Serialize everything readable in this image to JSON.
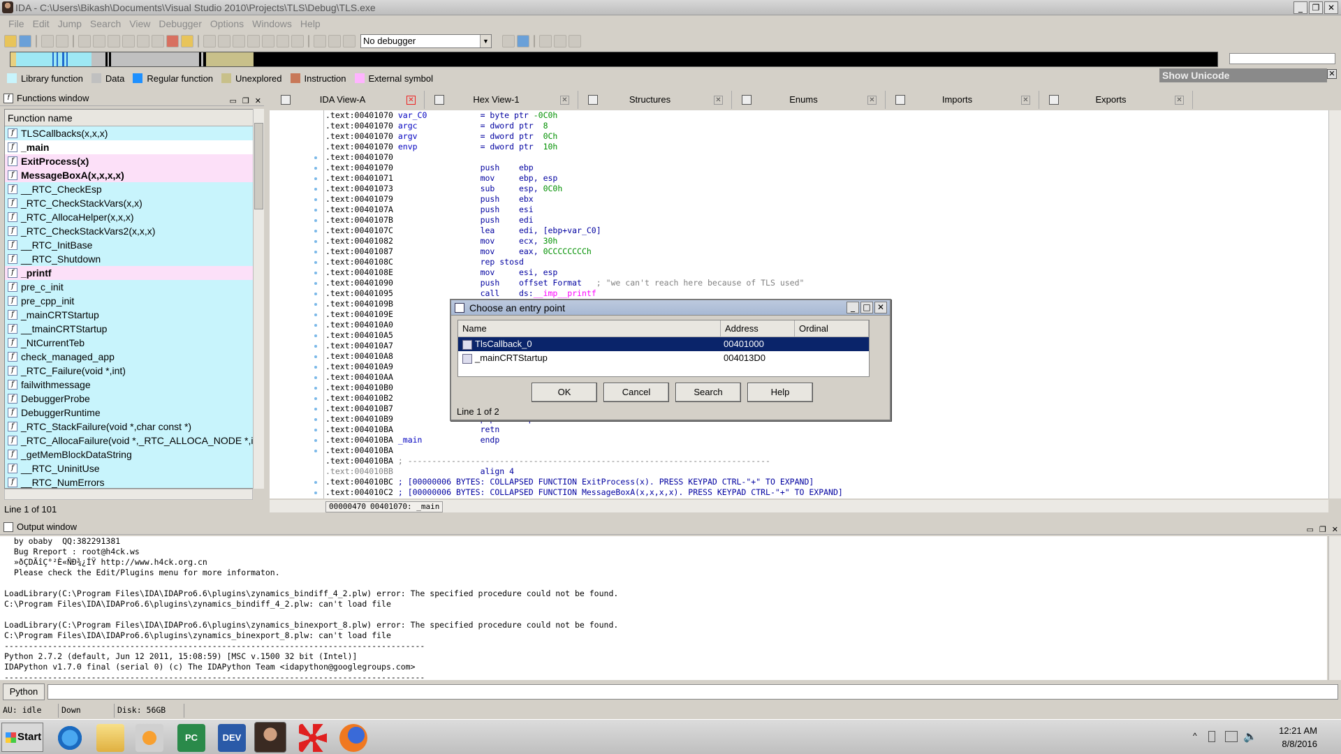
{
  "window": {
    "title": "IDA - C:\\Users\\Bikash\\Documents\\Visual Studio 2010\\Projects\\TLS\\Debug\\TLS.exe"
  },
  "menu": [
    "File",
    "Edit",
    "Jump",
    "Search",
    "View",
    "Debugger",
    "Options",
    "Windows",
    "Help"
  ],
  "toolbar": {
    "debugger_value": "No debugger"
  },
  "legend": [
    {
      "label": "Library function",
      "color": "#c8f4fc"
    },
    {
      "label": "Data",
      "color": "#c0c0c0"
    },
    {
      "label": "Regular function",
      "color": "#1e90ff"
    },
    {
      "label": "Unexplored",
      "color": "#c8c08a"
    },
    {
      "label": "Instruction",
      "color": "#c87858"
    },
    {
      "label": "External symbol",
      "color": "#ffb4ff"
    }
  ],
  "show_unicode": "Show Unicode",
  "functions_window": {
    "title": "Functions window",
    "column": "Function name",
    "status": "Line 1 of 101",
    "items": [
      {
        "name": "TLSCallbacks(x,x,x)",
        "type": "lib",
        "bold": false
      },
      {
        "name": "_main",
        "type": "reg",
        "bold": true
      },
      {
        "name": "ExitProcess(x)",
        "type": "ext",
        "bold": true
      },
      {
        "name": "MessageBoxA(x,x,x,x)",
        "type": "ext",
        "bold": true
      },
      {
        "name": "__RTC_CheckEsp",
        "type": "lib",
        "bold": false
      },
      {
        "name": "_RTC_CheckStackVars(x,x)",
        "type": "lib",
        "bold": false
      },
      {
        "name": "_RTC_AllocaHelper(x,x,x)",
        "type": "lib",
        "bold": false
      },
      {
        "name": "_RTC_CheckStackVars2(x,x,x)",
        "type": "lib",
        "bold": false
      },
      {
        "name": "__RTC_InitBase",
        "type": "lib",
        "bold": false
      },
      {
        "name": "__RTC_Shutdown",
        "type": "lib",
        "bold": false
      },
      {
        "name": "_printf",
        "type": "ext",
        "bold": true
      },
      {
        "name": "pre_c_init",
        "type": "lib",
        "bold": false
      },
      {
        "name": "pre_cpp_init",
        "type": "lib",
        "bold": false
      },
      {
        "name": "_mainCRTStartup",
        "type": "lib",
        "bold": false
      },
      {
        "name": "__tmainCRTStartup",
        "type": "lib",
        "bold": false
      },
      {
        "name": "_NtCurrentTeb",
        "type": "lib",
        "bold": false
      },
      {
        "name": "check_managed_app",
        "type": "lib",
        "bold": false
      },
      {
        "name": "_RTC_Failure(void *,int)",
        "type": "lib",
        "bold": false
      },
      {
        "name": "failwithmessage",
        "type": "lib",
        "bold": false
      },
      {
        "name": "DebuggerProbe",
        "type": "lib",
        "bold": false
      },
      {
        "name": "DebuggerRuntime",
        "type": "lib",
        "bold": false
      },
      {
        "name": "_RTC_StackFailure(void *,char const *)",
        "type": "lib",
        "bold": false
      },
      {
        "name": "_RTC_AllocaFailure(void *,_RTC_ALLOCA_NODE *,int)",
        "type": "lib",
        "bold": false
      },
      {
        "name": "_getMemBlockDataString",
        "type": "lib",
        "bold": false
      },
      {
        "name": "__RTC_UninitUse",
        "type": "lib",
        "bold": false
      },
      {
        "name": "__RTC_NumErrors",
        "type": "lib",
        "bold": false
      }
    ]
  },
  "tabs": [
    {
      "label": "IDA View-A",
      "active": true
    },
    {
      "label": "Hex View-1",
      "active": false
    },
    {
      "label": "Structures",
      "active": false
    },
    {
      "label": "Enums",
      "active": false
    },
    {
      "label": "Imports",
      "active": false
    },
    {
      "label": "Exports",
      "active": false
    }
  ],
  "disasm": {
    "status_offset": "00000470",
    "status_location": "00401070: _main",
    "lines": [
      [
        [
          "addr",
          ".text:00401070 "
        ],
        [
          "lbl",
          "var_C0           "
        ],
        [
          "mn",
          "= byte ptr "
        ],
        [
          "num",
          "-0C0h"
        ]
      ],
      [
        [
          "addr",
          ".text:00401070 "
        ],
        [
          "lbl",
          "argc             "
        ],
        [
          "mn",
          "= dword ptr  "
        ],
        [
          "num",
          "8"
        ]
      ],
      [
        [
          "addr",
          ".text:00401070 "
        ],
        [
          "lbl",
          "argv             "
        ],
        [
          "mn",
          "= dword ptr  "
        ],
        [
          "num",
          "0Ch"
        ]
      ],
      [
        [
          "addr",
          ".text:00401070 "
        ],
        [
          "lbl",
          "envp             "
        ],
        [
          "mn",
          "= dword ptr  "
        ],
        [
          "num",
          "10h"
        ]
      ],
      [
        [
          "addr",
          ".text:00401070"
        ]
      ],
      [
        [
          "addr",
          ".text:00401070                  "
        ],
        [
          "mn",
          "push    ebp"
        ]
      ],
      [
        [
          "addr",
          ".text:00401071                  "
        ],
        [
          "mn",
          "mov     ebp, esp"
        ]
      ],
      [
        [
          "addr",
          ".text:00401073                  "
        ],
        [
          "mn",
          "sub     esp, "
        ],
        [
          "num",
          "0C0h"
        ]
      ],
      [
        [
          "addr",
          ".text:00401079                  "
        ],
        [
          "mn",
          "push    ebx"
        ]
      ],
      [
        [
          "addr",
          ".text:0040107A                  "
        ],
        [
          "mn",
          "push    esi"
        ]
      ],
      [
        [
          "addr",
          ".text:0040107B                  "
        ],
        [
          "mn",
          "push    edi"
        ]
      ],
      [
        [
          "addr",
          ".text:0040107C                  "
        ],
        [
          "mn",
          "lea     edi, [ebp+var_C0]"
        ]
      ],
      [
        [
          "addr",
          ".text:00401082                  "
        ],
        [
          "mn",
          "mov     ecx, "
        ],
        [
          "num",
          "30h"
        ]
      ],
      [
        [
          "addr",
          ".text:00401087                  "
        ],
        [
          "mn",
          "mov     eax, "
        ],
        [
          "num",
          "0CCCCCCCCh"
        ]
      ],
      [
        [
          "addr",
          ".text:0040108C                  "
        ],
        [
          "mn",
          "rep stosd"
        ]
      ],
      [
        [
          "addr",
          ".text:0040108E                  "
        ],
        [
          "mn",
          "mov     esi, esp"
        ]
      ],
      [
        [
          "addr",
          ".text:00401090                  "
        ],
        [
          "mn",
          "push    offset Format   "
        ],
        [
          "cmt",
          "; \"we can't reach here because of TLS used\""
        ]
      ],
      [
        [
          "addr",
          ".text:00401095                  "
        ],
        [
          "mn",
          "call    ds:"
        ],
        [
          "imp",
          "__imp__printf"
        ]
      ],
      [
        [
          "addr",
          ".text:0040109B"
        ]
      ],
      [
        [
          "addr",
          ".text:0040109E"
        ]
      ],
      [
        [
          "addr",
          ".text:004010A0"
        ]
      ],
      [
        [
          "addr",
          ".text:004010A5"
        ]
      ],
      [
        [
          "addr",
          ".text:004010A7"
        ]
      ],
      [
        [
          "addr",
          ".text:004010A8"
        ]
      ],
      [
        [
          "addr",
          ".text:004010A9"
        ]
      ],
      [
        [
          "addr",
          ".text:004010AA"
        ]
      ],
      [
        [
          "addr",
          ".text:004010B0"
        ]
      ],
      [
        [
          "addr",
          ".text:004010B2"
        ]
      ],
      [
        [
          "addr",
          ".text:004010B7"
        ]
      ],
      [
        [
          "addr",
          ".text:004010B9                  "
        ],
        [
          "mn",
          "pop     ebp"
        ]
      ],
      [
        [
          "addr",
          ".text:004010BA                  "
        ],
        [
          "mn",
          "retn"
        ]
      ],
      [
        [
          "addr",
          ".text:004010BA "
        ],
        [
          "lbl",
          "_main            "
        ],
        [
          "mn",
          "endp"
        ]
      ],
      [
        [
          "addr",
          ".text:004010BA"
        ]
      ],
      [
        [
          "addr",
          ".text:004010BA "
        ],
        [
          "sep",
          "; ---------------------------------------------------------------------------"
        ]
      ],
      [
        [
          "gray",
          ".text:004010BB                  "
        ],
        [
          "mn",
          "align 4"
        ]
      ],
      [
        [
          "addr",
          ".text:004010BC "
        ],
        [
          "mn",
          "; [00000006 BYTES: COLLAPSED FUNCTION ExitProcess(x). PRESS KEYPAD CTRL-\"+\" TO EXPAND]"
        ]
      ],
      [
        [
          "addr",
          ".text:004010C2 "
        ],
        [
          "mn",
          "; [00000006 BYTES: COLLAPSED FUNCTION MessageBoxA(x,x,x,x). PRESS KEYPAD CTRL-\"+\" TO EXPAND]"
        ]
      ]
    ]
  },
  "dialog": {
    "title": "Choose an entry point",
    "columns": [
      "Name",
      "Address",
      "Ordinal"
    ],
    "rows": [
      {
        "name": "TlsCallback_0",
        "address": "00401000",
        "ordinal": ""
      },
      {
        "name": "_mainCRTStartup",
        "address": "004013D0",
        "ordinal": ""
      }
    ],
    "buttons": {
      "ok": "OK",
      "cancel": "Cancel",
      "search": "Search",
      "help": "Help"
    },
    "status": "Line 1 of 2"
  },
  "output_window": {
    "title": "Output window",
    "lines": [
      "  by obaby  QQ:382291381",
      "  Bug Rreport : root@h4ck.ws",
      "  »ðÇDÃîÇ°²È«ÑÐ¾¿ÍŸ http://www.h4ck.org.cn",
      "  Please check the Edit/Plugins menu for more informaton.",
      "",
      "LoadLibrary(C:\\Program Files\\IDA\\IDAPro6.6\\plugins\\zynamics_bindiff_4_2.plw) error: The specified procedure could not be found.",
      "C:\\Program Files\\IDA\\IDAPro6.6\\plugins\\zynamics_bindiff_4_2.plw: can't load file",
      "",
      "LoadLibrary(C:\\Program Files\\IDA\\IDAPro6.6\\plugins\\zynamics_binexport_8.plw) error: The specified procedure could not be found.",
      "C:\\Program Files\\IDA\\IDAPro6.6\\plugins\\zynamics_binexport_8.plw: can't load file",
      "---------------------------------------------------------------------------------------",
      "Python 2.7.2 (default, Jun 12 2011, 15:08:59) [MSC v.1500 32 bit (Intel)]",
      "IDAPython v1.7.0 final (serial 0) (c) The IDAPython Team <idapython@googlegroups.com>",
      "---------------------------------------------------------------------------------------"
    ],
    "python_label": "Python"
  },
  "statusbar": {
    "au": "AU:  idle",
    "dir": "Down",
    "disk": "Disk: 56GB"
  },
  "taskbar": {
    "start": "Start",
    "time": "12:21 AM",
    "date": "8/8/2016"
  }
}
